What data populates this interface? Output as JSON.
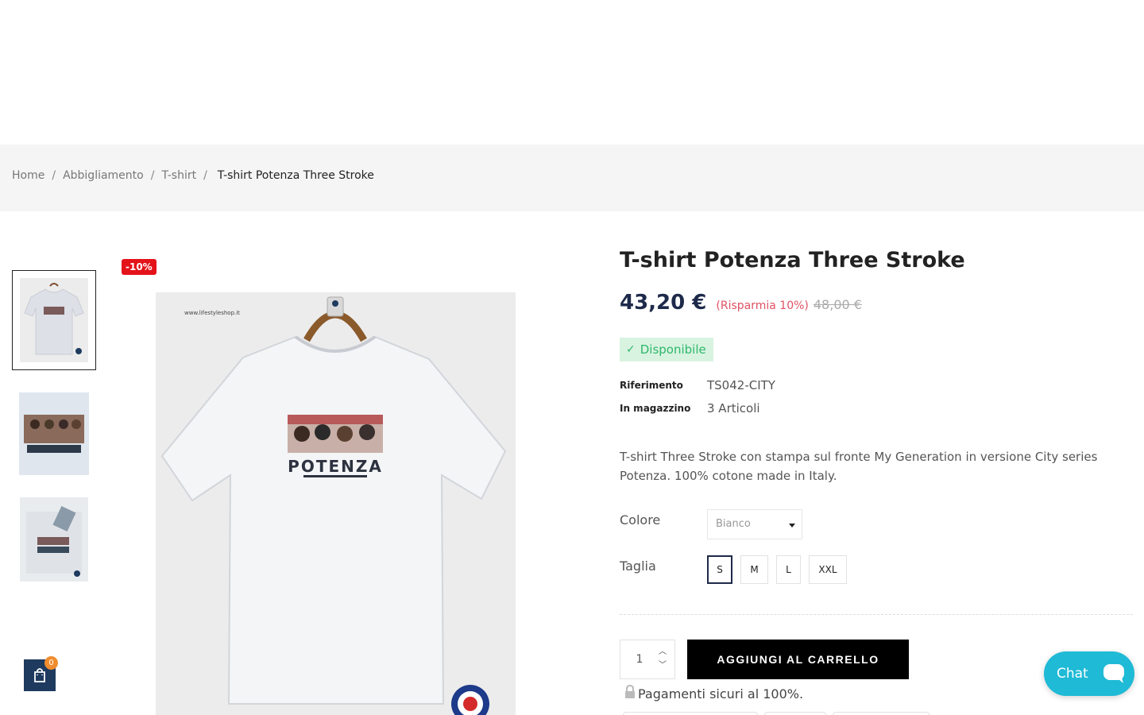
{
  "breadcrumb": {
    "items": [
      "Home",
      "Abbigliamento",
      "T-shirt"
    ],
    "separator": "/",
    "current": "T-shirt Potenza Three Stroke"
  },
  "gallery": {
    "discount_badge": "-10%",
    "image_watermark": "www.lifestyleshop.it",
    "print_text": "POTENZA"
  },
  "product": {
    "title": "T-shirt Potenza Three Stroke",
    "price": "43,20 €",
    "save": "(Risparmia 10%)",
    "old_price": "48,00 €",
    "availability": "Disponibile",
    "reference_label": "Riferimento",
    "reference_value": "TS042-CITY",
    "stock_label": "In magazzino",
    "stock_value": "3 Articoli",
    "description": "T-shirt Three Stroke con stampa sul fronte My Generation in versione City series Potenza. 100% cotone made in Italy."
  },
  "options": {
    "color_label": "Colore",
    "color_selected": "Bianco",
    "size_label": "Taglia",
    "sizes": [
      "S",
      "M",
      "L",
      "XXL"
    ],
    "size_selected": "S"
  },
  "purchase": {
    "quantity": "1",
    "add_to_cart": "AGGIUNGI AL CARRELLO",
    "secure_payment": "Pagamenti sicuri al 100%."
  },
  "cart": {
    "count": "0"
  },
  "chat": {
    "label": "Chat"
  },
  "colors": {
    "accent_navy": "#1e2a4a",
    "badge_red": "#e4131a",
    "available_green": "#2fb86a",
    "chat_teal": "#1fbad6",
    "cart_orange": "#f08c2e"
  }
}
